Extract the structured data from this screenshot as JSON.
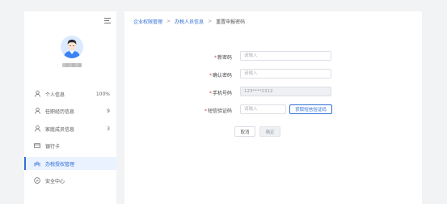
{
  "sidebar": {
    "items": [
      {
        "icon": "user-icon",
        "label": "个人信息",
        "value": "100%"
      },
      {
        "icon": "user-icon",
        "label": "任职经历信息",
        "value": "9"
      },
      {
        "icon": "user-icon",
        "label": "家庭成员信息",
        "value": "3"
      },
      {
        "icon": "card-icon",
        "label": "银行卡",
        "value": ""
      },
      {
        "icon": "team-icon",
        "label": "办税授权管理",
        "value": "",
        "active": true
      },
      {
        "icon": "shield-icon",
        "label": "安全中心",
        "value": ""
      }
    ]
  },
  "breadcrumb": {
    "items": [
      "企业权限管理",
      "办税人员信息",
      "重置申报密码"
    ],
    "separator": ">"
  },
  "form": {
    "new_password": {
      "label": "新密码",
      "placeholder": "请输入",
      "value": ""
    },
    "confirm_password": {
      "label": "确认密码",
      "placeholder": "请输入",
      "value": ""
    },
    "phone": {
      "label": "手机号码",
      "value": "123****2312"
    },
    "sms_code": {
      "label": "短信验证码",
      "placeholder": "请输入",
      "value": "",
      "button_label": "获取短信验证码"
    },
    "required_mark": "*"
  },
  "actions": {
    "cancel_label": "取消",
    "confirm_label": "确定"
  },
  "colors": {
    "accent": "#2f6fd6",
    "required": "#e54545",
    "page_bg": "#f2f3f5",
    "active_bg": "#eaf2ff"
  }
}
